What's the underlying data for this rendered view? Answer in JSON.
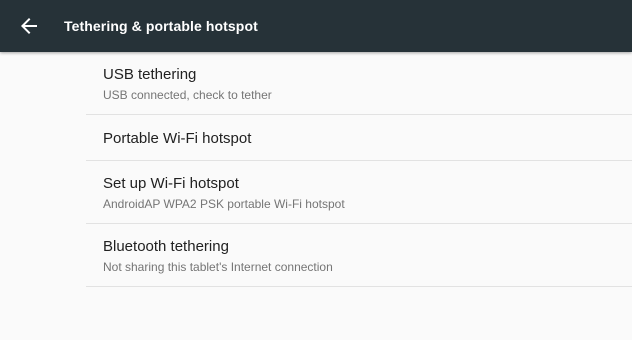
{
  "header": {
    "back_icon": "arrow-back-icon",
    "title": "Tethering & portable hotspot",
    "background_color": "#263238",
    "text_color": "#ffffff"
  },
  "settings": {
    "items": [
      {
        "title": "USB tethering",
        "summary": "USB connected, check to tether"
      },
      {
        "title": "Portable Wi-Fi hotspot"
      },
      {
        "title": "Set up Wi-Fi hotspot",
        "summary": "AndroidAP WPA2 PSK portable Wi-Fi hotspot"
      },
      {
        "title": "Bluetooth tethering",
        "summary": "Not sharing this tablet's Internet connection"
      }
    ]
  }
}
